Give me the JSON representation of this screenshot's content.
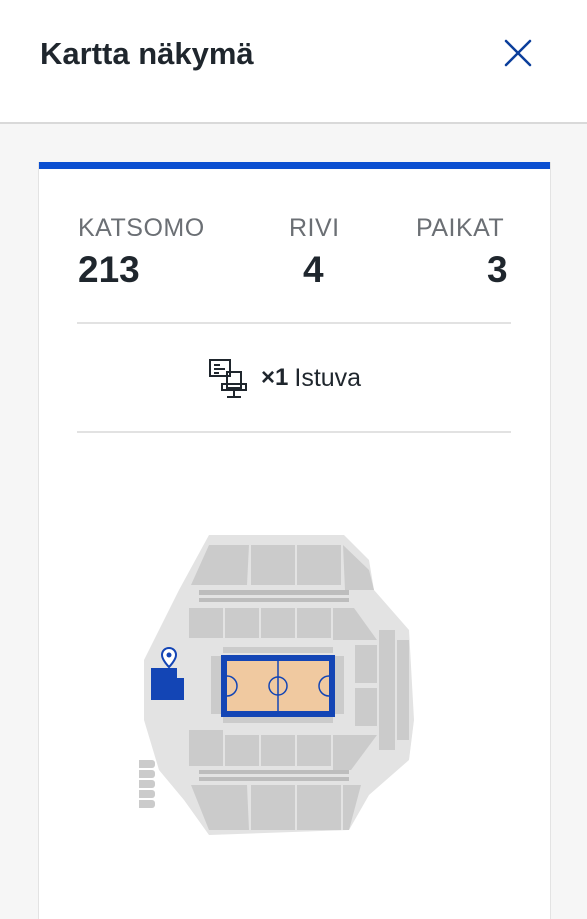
{
  "header": {
    "title": "Kartta näkymä",
    "close_icon": "close-x-icon",
    "close_color": "#0b3e9b"
  },
  "ticket": {
    "accent_color": "#0b4fd1",
    "section_label": "KATSOMO",
    "section_value": "213",
    "row_label": "RIVI",
    "row_value": "4",
    "seats_label": "PAIKAT",
    "seats_value": "3",
    "type_icon": "seat-chair-icon",
    "type_quantity": "×1",
    "type_label": "Istuva"
  },
  "map": {
    "venue_fill": "#e3e3e3",
    "section_fill": "#cbcbcb",
    "selected_section_fill": "#1345b5",
    "court_fill": "#f0c9a0",
    "court_border": "#1345b5",
    "marker_icon": "location-pin-icon"
  }
}
